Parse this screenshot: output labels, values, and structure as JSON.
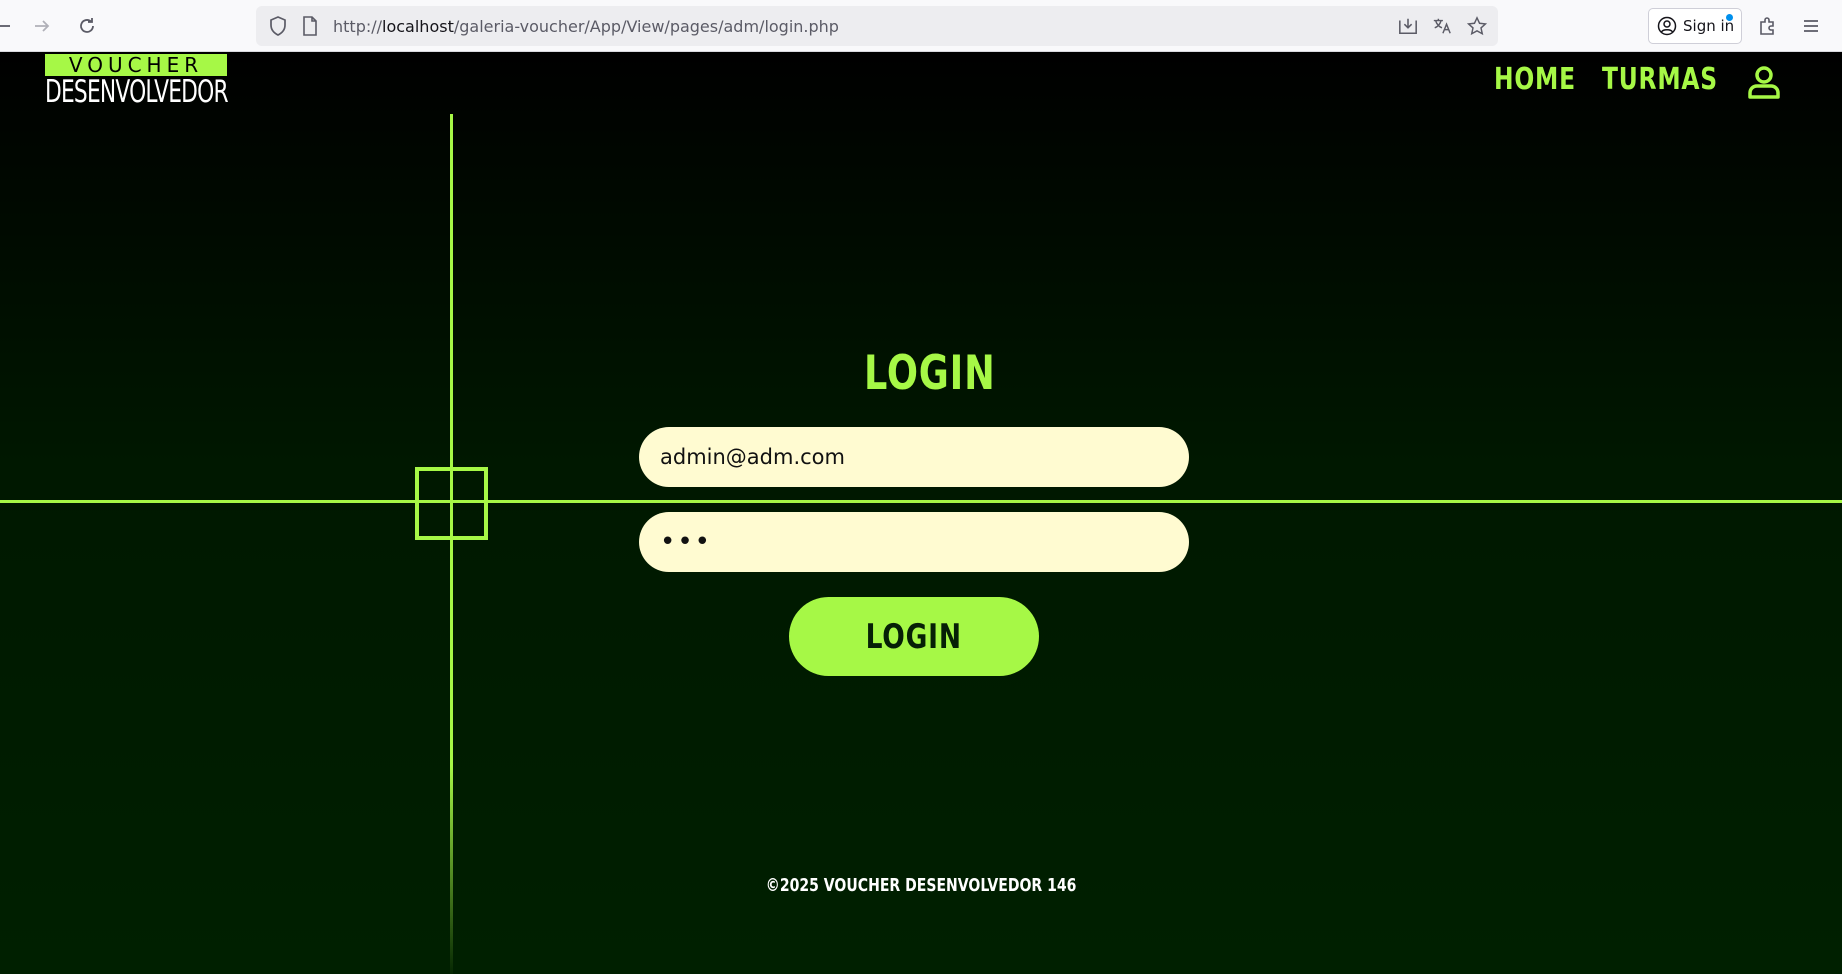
{
  "browser": {
    "url_prefix": "http://",
    "url_host": "localhost",
    "url_path": "/galeria-voucher/App/View/pages/adm/login.php",
    "signin_label": "Sign in",
    "icons": [
      "back-icon",
      "forward-icon",
      "reload-icon",
      "shield-icon",
      "page-icon",
      "download-icon",
      "translate-icon",
      "star-icon",
      "account-icon",
      "extensions-icon",
      "menu-icon"
    ]
  },
  "header": {
    "logo_top": "VOUCHER",
    "logo_bottom": "DESENVOLVEDOR",
    "nav": [
      "HOME",
      "TURMAS"
    ]
  },
  "login": {
    "title": "LOGIN",
    "email_value": "admin@adm.com",
    "password_mask": "•••",
    "button_label": "LOGIN"
  },
  "footer": {
    "text": "©2025 VOUCHER DESENVOLVEDOR 146"
  },
  "colors": {
    "accent": "#a6f846",
    "input_bg": "#fffbd1",
    "bg_dark": "#001a00"
  }
}
